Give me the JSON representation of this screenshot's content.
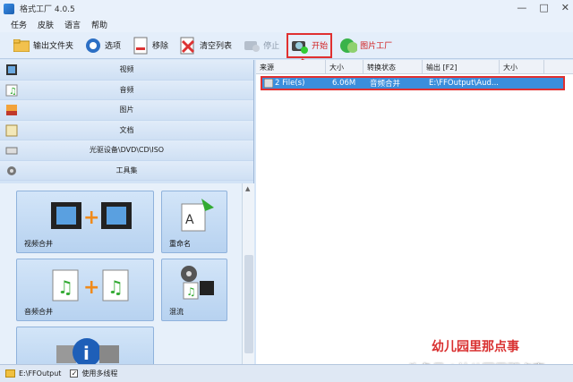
{
  "window": {
    "title": "格式工厂 4.0.5",
    "controls": [
      "—",
      "□",
      "✕"
    ]
  },
  "menu": [
    "任务",
    "皮肤",
    "语言",
    "帮助"
  ],
  "toolbar": {
    "output_folder": "输出文件夹",
    "options": "选项",
    "remove": "移除",
    "clear_list": "清空列表",
    "stop": "停止",
    "start": "开始",
    "picture_factory": "图片工厂"
  },
  "categories": [
    "视频",
    "音频",
    "图片",
    "文档",
    "光驱设备\\DVD\\CD\\ISO",
    "工具集"
  ],
  "tiles": {
    "video_merge": "视频合并",
    "rename": "重命名",
    "audio_merge": "音频合并",
    "mix": "混流"
  },
  "columns": [
    "来源",
    "大小",
    "转换状态",
    "输出 [F2]",
    "大小"
  ],
  "row": {
    "source": "2 File(s)",
    "size": "6.06M",
    "status": "音频合并",
    "output": "E:\\FFOutput\\Aud..."
  },
  "status": {
    "path": "E:\\FFOutput",
    "multithread": "使用多线程"
  },
  "watermark": {
    "red": "幼儿园里那点事",
    "white": "头条号 / 幼儿园里那点事"
  },
  "colors": {
    "accent": "#3b8edc",
    "highlight": "#e03030"
  }
}
